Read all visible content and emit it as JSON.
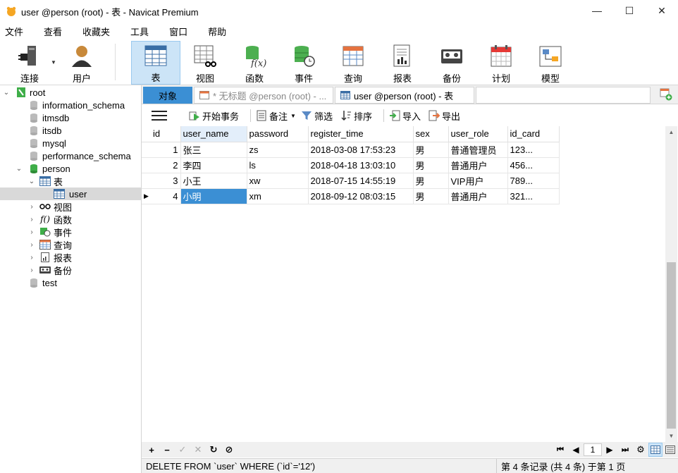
{
  "window": {
    "title": "user @person (root) - 表 - Navicat Premium",
    "controls": {
      "minimize": "—",
      "maximize": "☐",
      "close": "✕"
    }
  },
  "menu": [
    "文件",
    "查看",
    "收藏夹",
    "工具",
    "窗口",
    "帮助"
  ],
  "toolbar": [
    {
      "label": "连接",
      "icon": "connection-icon"
    },
    {
      "label": "用户",
      "icon": "user-icon"
    },
    {
      "label": "表",
      "icon": "table-icon",
      "active": true
    },
    {
      "label": "视图",
      "icon": "view-icon"
    },
    {
      "label": "函数",
      "icon": "function-icon"
    },
    {
      "label": "事件",
      "icon": "event-icon"
    },
    {
      "label": "查询",
      "icon": "query-icon"
    },
    {
      "label": "报表",
      "icon": "report-icon"
    },
    {
      "label": "备份",
      "icon": "backup-icon"
    },
    {
      "label": "计划",
      "icon": "schedule-icon"
    },
    {
      "label": "模型",
      "icon": "model-icon"
    }
  ],
  "tree": {
    "root": "root",
    "databases": [
      "information_schema",
      "itmsdb",
      "itsdb",
      "mysql",
      "performance_schema"
    ],
    "person": "person",
    "tables_label": "表",
    "table_user": "user",
    "children": [
      "视图",
      "函数",
      "事件",
      "查询",
      "报表",
      "备份"
    ],
    "test": "test"
  },
  "tabs": {
    "objects": "对象",
    "untitled": "* 无标题 @person (root) - ...",
    "user": "user @person (root) - 表"
  },
  "data_toolbar": {
    "begin_tx": "开始事务",
    "memo": "备注",
    "filter": "筛选",
    "sort": "排序",
    "import": "导入",
    "export": "导出"
  },
  "grid": {
    "columns": [
      "id",
      "user_name",
      "password",
      "register_time",
      "sex",
      "user_role",
      "id_card"
    ],
    "rows": [
      [
        "1",
        "张三",
        "zs",
        "2018-03-08 17:53:23",
        "男",
        "普通管理员",
        "123..."
      ],
      [
        "2",
        "李四",
        "ls",
        "2018-04-18 13:03:10",
        "男",
        "普通用户",
        "456..."
      ],
      [
        "3",
        "小王",
        "xw",
        "2018-07-15 14:55:19",
        "男",
        "VIP用户",
        "789..."
      ],
      [
        "4",
        "小明",
        "xm",
        "2018-09-12 08:03:15",
        "男",
        "普通用户",
        "321..."
      ]
    ],
    "row_pointer": "▶"
  },
  "nav": {
    "page": "1"
  },
  "status": {
    "sql": "DELETE FROM `user` WHERE (`id`='12')",
    "records": "第 4 条记录 (共 4 条) 于第 1 页"
  }
}
